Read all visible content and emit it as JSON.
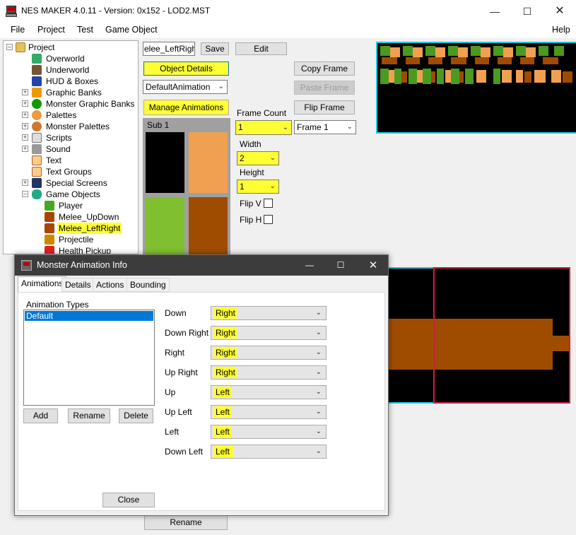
{
  "window": {
    "title": "NES MAKER 4.0.11 - Version: 0x152 - LOD2.MST"
  },
  "menu": {
    "file": "File",
    "project": "Project",
    "test": "Test",
    "game_object": "Game Object",
    "help": "Help"
  },
  "tree": {
    "root": "Project",
    "items": [
      "Overworld",
      "Underworld",
      "HUD & Boxes",
      "Graphic Banks",
      "Monster Graphic Banks",
      "Palettes",
      "Monster Palettes",
      "Scripts",
      "Sound",
      "Text",
      "Text Groups",
      "Special Screens",
      "Game Objects"
    ],
    "children": [
      "Player",
      "Melee_UpDown",
      "Melee_LeftRight",
      "Projectile",
      "Health Pickup"
    ]
  },
  "editor": {
    "name_value": "elee_LeftRight",
    "save": "Save",
    "edit": "Edit",
    "object_details": "Object Details",
    "animation_select": "DefaultAnimation",
    "manage_animations": "Manage Animations",
    "copy_frame": "Copy Frame",
    "paste_frame": "Paste Frame",
    "flip_frame": "Flip Frame",
    "frame_count_label": "Frame Count",
    "frame_count_value": "1",
    "frame_select": "Frame 1",
    "width_label": "Width",
    "width_value": "2",
    "height_label": "Height",
    "height_value": "1",
    "flip_v": "Flip V",
    "flip_h": "Flip H",
    "sub_label": "Sub 1",
    "rename": "Rename"
  },
  "palette_swatches": [
    "#000000",
    "#f0a050",
    "#80c030",
    "#a04c00"
  ],
  "dialog": {
    "title": "Monster Animation Info",
    "tabs": [
      "Animations",
      "Details",
      "Actions",
      "Bounding Box"
    ],
    "animation_types_label": "Animation Types",
    "list_items": [
      "Default"
    ],
    "add": "Add",
    "rename": "Rename",
    "delete": "Delete",
    "close": "Close",
    "directions": [
      {
        "label": "Down",
        "value": "Right"
      },
      {
        "label": "Down Right",
        "value": "Right"
      },
      {
        "label": "Right",
        "value": "Right"
      },
      {
        "label": "Up Right",
        "value": "Right"
      },
      {
        "label": "Up",
        "value": "Left"
      },
      {
        "label": "Up Left",
        "value": "Left"
      },
      {
        "label": "Left",
        "value": "Left"
      },
      {
        "label": "Down Left",
        "value": "Left"
      }
    ]
  },
  "colors": {
    "highlight": "#ffff33",
    "sprite_brown": "#a04c00",
    "cyan_border": "#1ec8e0",
    "red_border": "#d0203c",
    "green": "#80c030",
    "orange": "#f0a050"
  }
}
